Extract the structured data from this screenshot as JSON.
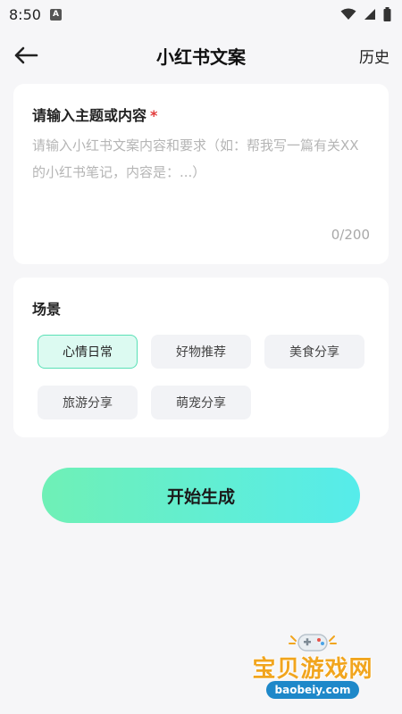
{
  "status_bar": {
    "time": "8:50",
    "app_badge": "A",
    "icons": [
      "wifi-icon",
      "signal-icon",
      "battery-icon"
    ]
  },
  "header": {
    "title": "小红书文案",
    "back_icon": "arrow-left-icon",
    "history_label": "历史"
  },
  "input_card": {
    "label": "请输入主题或内容",
    "required_mark": "*",
    "placeholder": "请输入小红书文案内容和要求（如：帮我写一篇有关XX的小红书笔记，内容是：...）",
    "value": "",
    "counter": "0/200"
  },
  "scene_card": {
    "title": "场景",
    "chips": [
      {
        "label": "心情日常",
        "selected": true
      },
      {
        "label": "好物推荐",
        "selected": false
      },
      {
        "label": "美食分享",
        "selected": false
      },
      {
        "label": "旅游分享",
        "selected": false
      },
      {
        "label": "萌宠分享",
        "selected": false
      }
    ]
  },
  "generate_button": {
    "label": "开始生成"
  },
  "watermark": {
    "text": "宝贝游戏网",
    "url": "baobeiy.com"
  },
  "colors": {
    "accent_start": "#6ff0b6",
    "accent_end": "#56eceb",
    "selected_chip_bg": "#dcfaf1",
    "selected_chip_border": "#59e0b6",
    "required_star": "#e23b3b"
  }
}
